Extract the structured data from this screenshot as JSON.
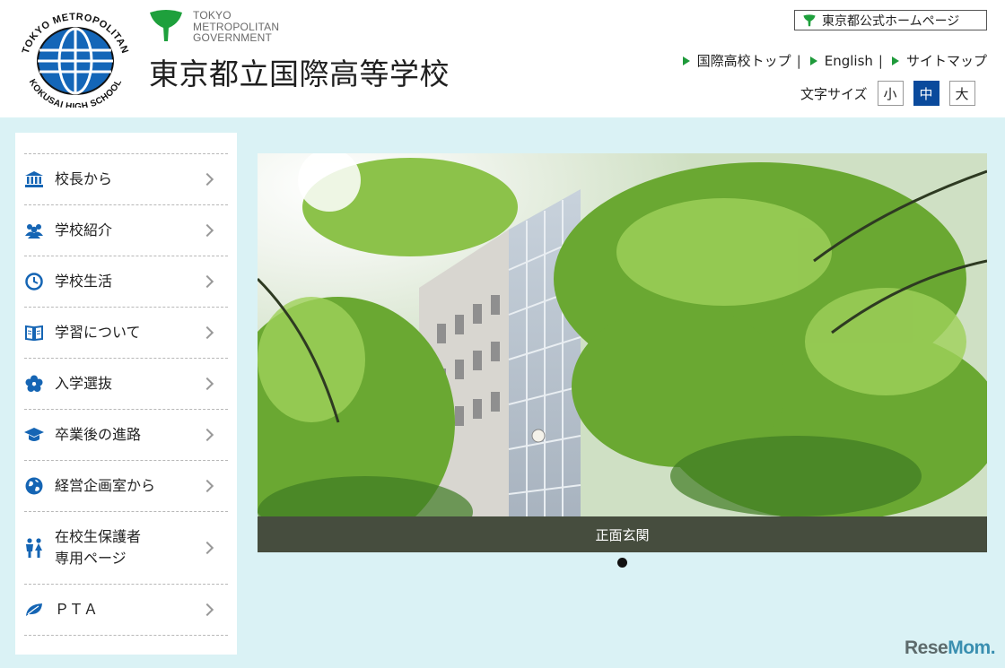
{
  "header": {
    "emblem_text_top": "TOKYO METROPOLITAN",
    "emblem_text_bottom": "KOKUSAI HIGH SCHOOL",
    "tmg_line1": "TOKYO",
    "tmg_line2": "METROPOLITAN",
    "tmg_line3": "GOVERNMENT",
    "school_name": "東京都立国際高等学校",
    "official_link": "東京都公式ホームページ",
    "links": [
      "国際高校トップ",
      "English",
      "サイトマップ"
    ],
    "link_separator": "|",
    "font_size_label": "文字サイズ",
    "font_sizes": [
      "小",
      "中",
      "大"
    ],
    "font_size_selected": "中"
  },
  "sidebar": {
    "items": [
      {
        "label": "校長から",
        "icon": "building-icon"
      },
      {
        "label": "学校紹介",
        "icon": "group-icon"
      },
      {
        "label": "学校生活",
        "icon": "clock-icon"
      },
      {
        "label": "学習について",
        "icon": "book-icon"
      },
      {
        "label": "入学選抜",
        "icon": "flower-icon"
      },
      {
        "label": "卒業後の進路",
        "icon": "graduation-cap-icon"
      },
      {
        "label": "経営企画室から",
        "icon": "globe-icon"
      },
      {
        "label": "在校生保護者\n専用ページ",
        "icon": "parents-icon"
      },
      {
        "label": "ＰＴＡ",
        "icon": "leaf-icon"
      }
    ]
  },
  "hero": {
    "caption": "正面玄関",
    "slide_count": 1,
    "active_slide": 1
  },
  "watermark": {
    "text_a": "Rese",
    "text_b": "Mom",
    "text_c": "."
  },
  "colors": {
    "accent_blue": "#0a4a9c",
    "link_green": "#1e9a3a",
    "background": "#daf2f5"
  }
}
